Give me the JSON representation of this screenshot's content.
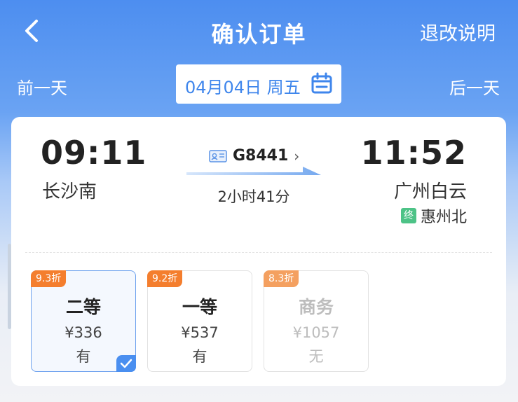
{
  "header": {
    "title": "确认订单",
    "refund_label": "退改说明"
  },
  "datebar": {
    "prev_label": "前一天",
    "date": "04月04日 周五",
    "next_label": "后一天"
  },
  "train": {
    "number": "G8441",
    "departure_time": "09:11",
    "departure_station": "长沙南",
    "arrival_time": "11:52",
    "arrival_station": "广州白云",
    "duration": "2小时41分",
    "terminal_tag": "终",
    "terminal_station": "惠州北"
  },
  "seats": [
    {
      "discount": "9.3折",
      "name": "二等",
      "price": "¥336",
      "availability": "有",
      "selected": true
    },
    {
      "discount": "9.2折",
      "name": "一等",
      "price": "¥537",
      "availability": "有",
      "selected": false
    },
    {
      "discount": "8.3折",
      "name": "商务",
      "price": "¥1057",
      "availability": "无",
      "selected": false
    }
  ],
  "colors": {
    "primary": "#4d8ef0",
    "discount": "#f47e2e",
    "terminal": "#4dc387"
  }
}
